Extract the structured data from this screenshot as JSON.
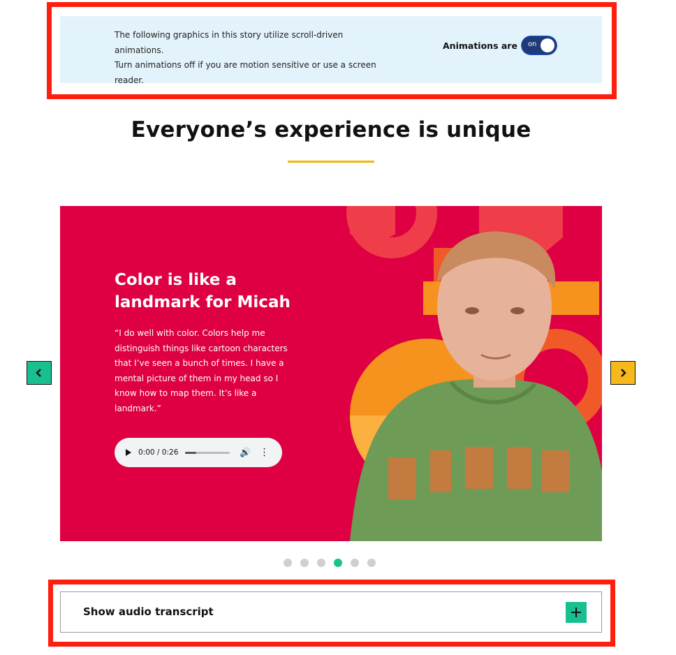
{
  "notice": {
    "text_line1": "The following graphics in this story utilize scroll-driven animations.",
    "text_line2": "Turn animations off if you are motion sensitive or use a screen",
    "text_line3": "reader.",
    "toggle_label": "Animations are",
    "toggle_state": "on"
  },
  "section": {
    "heading": "Everyone’s experience is unique",
    "accent_color": "#f2b705"
  },
  "slide": {
    "title_line1": "Color is like a",
    "title_line2": "landmark for Micah",
    "quote": "“I do well with color. Colors help me distinguish things like cartoon characters that I’ve seen a bunch of times. I have a mental picture of them in my head so I know how to map them. It’s like a landmark.”",
    "background_color": "#de0043",
    "audio": {
      "time": "0:00 / 0:26",
      "play_icon": "play-icon",
      "volume_icon": "volume-icon",
      "more_icon": "more-vertical-icon"
    }
  },
  "carousel": {
    "prev_icon": "chevron-left-icon",
    "next_icon": "chevron-right-icon",
    "prev_color": "#19c08f",
    "next_color": "#f7b81c",
    "total_slides": 6,
    "active_index": 3
  },
  "transcript": {
    "label": "Show audio transcript",
    "icon": "plus-icon"
  }
}
